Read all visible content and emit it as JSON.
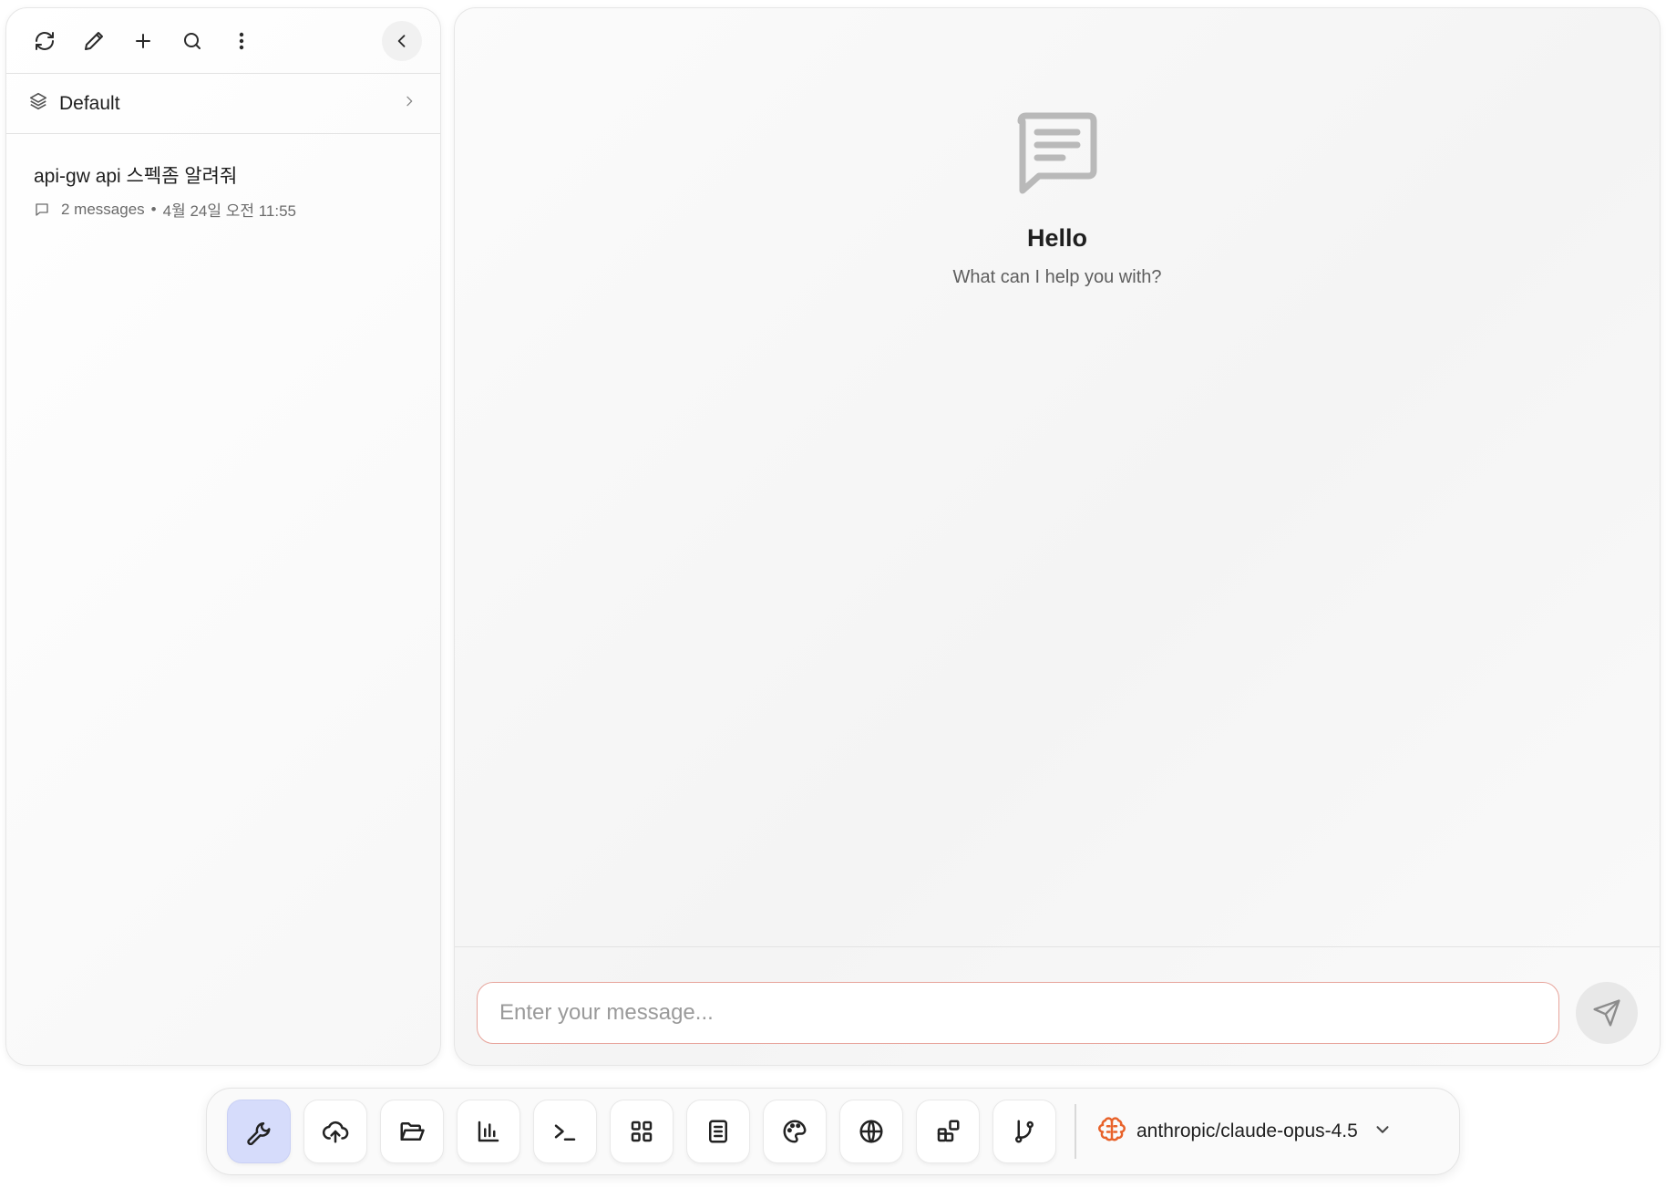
{
  "sidebar": {
    "toolbar_icons": [
      "refresh-icon",
      "pencil-icon",
      "plus-icon",
      "search-icon",
      "more-vertical-icon"
    ],
    "collapse_icon": "chevron-left-icon",
    "workspace": {
      "label": "Default",
      "icon": "layers-icon"
    },
    "conversations": [
      {
        "title": "api-gw api 스펙좀 알려줘",
        "message_count": "2 messages",
        "timestamp": "4월 24일 오전 11:55"
      }
    ]
  },
  "main": {
    "empty_state": {
      "title": "Hello",
      "subtitle": "What can I help you with?",
      "icon": "message-square-icon"
    },
    "composer": {
      "placeholder": "Enter your message...",
      "value": ""
    }
  },
  "dock": {
    "tools": [
      {
        "icon": "wrench-icon",
        "active": true
      },
      {
        "icon": "cloud-upload-icon",
        "active": false
      },
      {
        "icon": "folder-open-icon",
        "active": false
      },
      {
        "icon": "bar-chart-icon",
        "active": false
      },
      {
        "icon": "terminal-icon",
        "active": false
      },
      {
        "icon": "grid-icon",
        "active": false
      },
      {
        "icon": "notebook-icon",
        "active": false
      },
      {
        "icon": "palette-icon",
        "active": false
      },
      {
        "icon": "globe-icon",
        "active": false
      },
      {
        "icon": "blocks-icon",
        "active": false
      },
      {
        "icon": "git-branch-icon",
        "active": false
      }
    ],
    "model": {
      "name": "anthropic/claude-opus-4.5",
      "icon": "brain-icon",
      "icon_color": "#e8622a"
    }
  },
  "colors": {
    "active_tool_bg": "#d6dcfb",
    "input_border": "#e7a49b"
  }
}
